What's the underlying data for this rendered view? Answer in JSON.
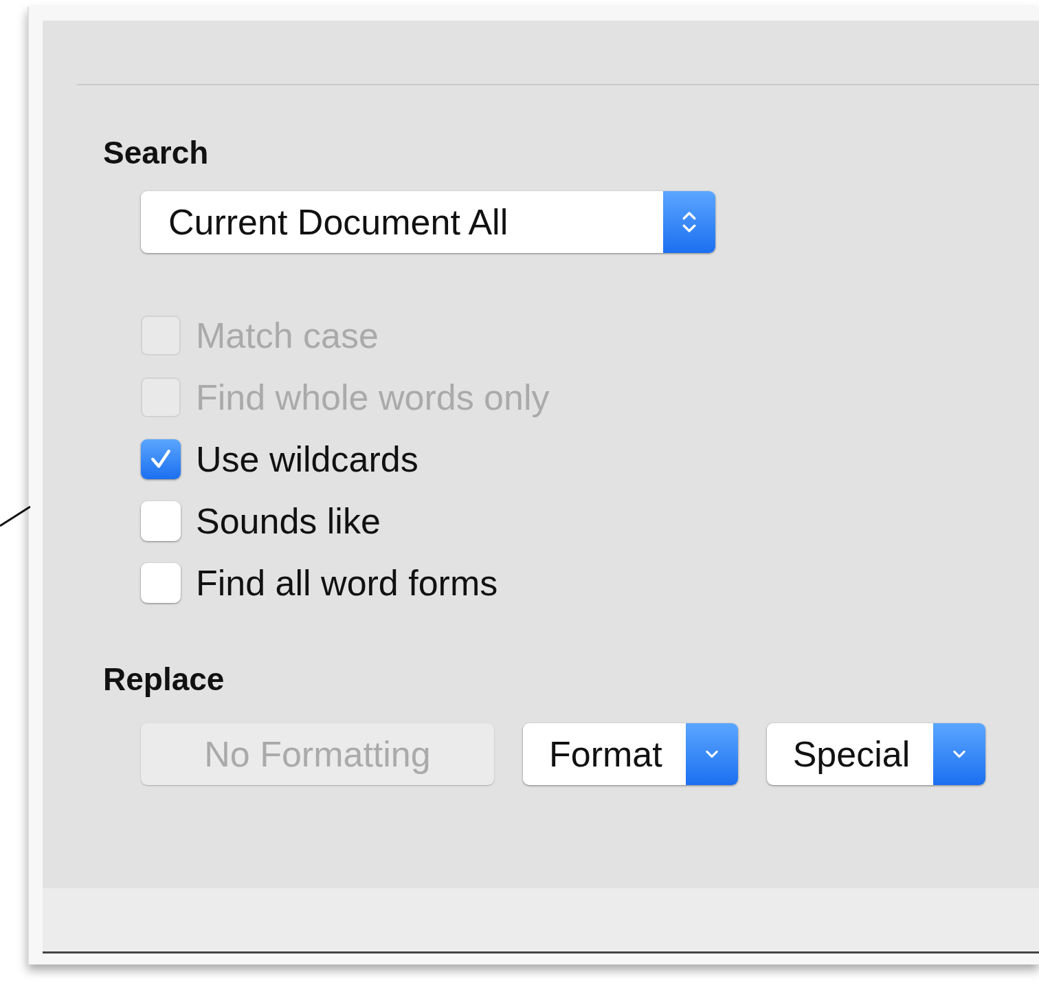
{
  "search": {
    "heading": "Search",
    "scope": {
      "value": "Current Document All"
    },
    "options": [
      {
        "label": "Match case",
        "checked": false,
        "disabled": true
      },
      {
        "label": "Find whole words only",
        "checked": false,
        "disabled": true
      },
      {
        "label": "Use wildcards",
        "checked": true,
        "disabled": false
      },
      {
        "label": "Sounds like",
        "checked": false,
        "disabled": false
      },
      {
        "label": "Find all word forms",
        "checked": false,
        "disabled": false
      }
    ]
  },
  "replace": {
    "heading": "Replace",
    "buttons": [
      {
        "label": "No Formatting",
        "kind": "button",
        "disabled": true
      },
      {
        "label": "Format",
        "kind": "menu",
        "disabled": false
      },
      {
        "label": "Special",
        "kind": "menu",
        "disabled": false
      }
    ]
  }
}
